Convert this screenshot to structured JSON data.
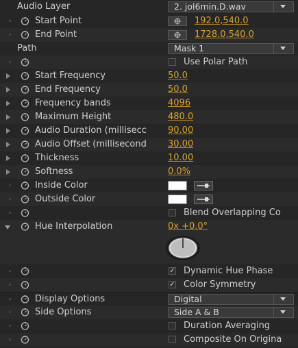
{
  "rows": [
    {
      "type": "dropdown",
      "label": "Audio Layer",
      "value": "2. jol6min.D.wav"
    },
    {
      "type": "point",
      "label": "Start Point",
      "value": "192.0,540.0"
    },
    {
      "type": "point",
      "label": "End Point",
      "value": "1728.0,540.0"
    },
    {
      "type": "dropdown",
      "label": "Path",
      "value": "Mask 1"
    },
    {
      "type": "checkbox",
      "label": "",
      "checkbox_label": "Use Polar Path",
      "checked": false
    },
    {
      "type": "value",
      "label": "Start Frequency",
      "value": "50.0"
    },
    {
      "type": "value",
      "label": "End Frequency",
      "value": "50.0"
    },
    {
      "type": "value",
      "label": "Frequency bands",
      "value": "4096"
    },
    {
      "type": "value",
      "label": "Maximum Height",
      "value": "480.0"
    },
    {
      "type": "value",
      "label": "Audio Duration (millisecc",
      "value": "90.00"
    },
    {
      "type": "value",
      "label": "Audio Offset (millisecond",
      "value": "30.00"
    },
    {
      "type": "value",
      "label": "Thickness",
      "value": "10.00"
    },
    {
      "type": "value",
      "label": "Softness",
      "value": "0.0%"
    },
    {
      "type": "color",
      "label": "Inside Color",
      "value": "#ffffff"
    },
    {
      "type": "color",
      "label": "Outside Color",
      "value": "#ffffff"
    },
    {
      "type": "checkbox",
      "label": "",
      "checkbox_label": "Blend Overlapping Co",
      "checked": false
    },
    {
      "type": "angle",
      "label": "Hue Interpolation",
      "value": "0x +0.0°"
    },
    {
      "type": "checkbox",
      "label": "",
      "checkbox_label": "Dynamic Hue Phase",
      "checked": true
    },
    {
      "type": "checkbox",
      "label": "",
      "checkbox_label": "Color Symmetry",
      "checked": true
    },
    {
      "type": "dropdown",
      "label": "Display Options",
      "value": "Digital"
    },
    {
      "type": "dropdown",
      "label": "Side Options",
      "value": "Side A & B"
    },
    {
      "type": "checkbox",
      "label": "",
      "checkbox_label": "Duration Averaging",
      "checked": false
    },
    {
      "type": "checkbox",
      "label": "",
      "checkbox_label": "Composite On Origina",
      "checked": false
    }
  ],
  "check_mark": "✓",
  "colors": {
    "value_accent": "#d9a531",
    "panel_bg": "#262626"
  }
}
